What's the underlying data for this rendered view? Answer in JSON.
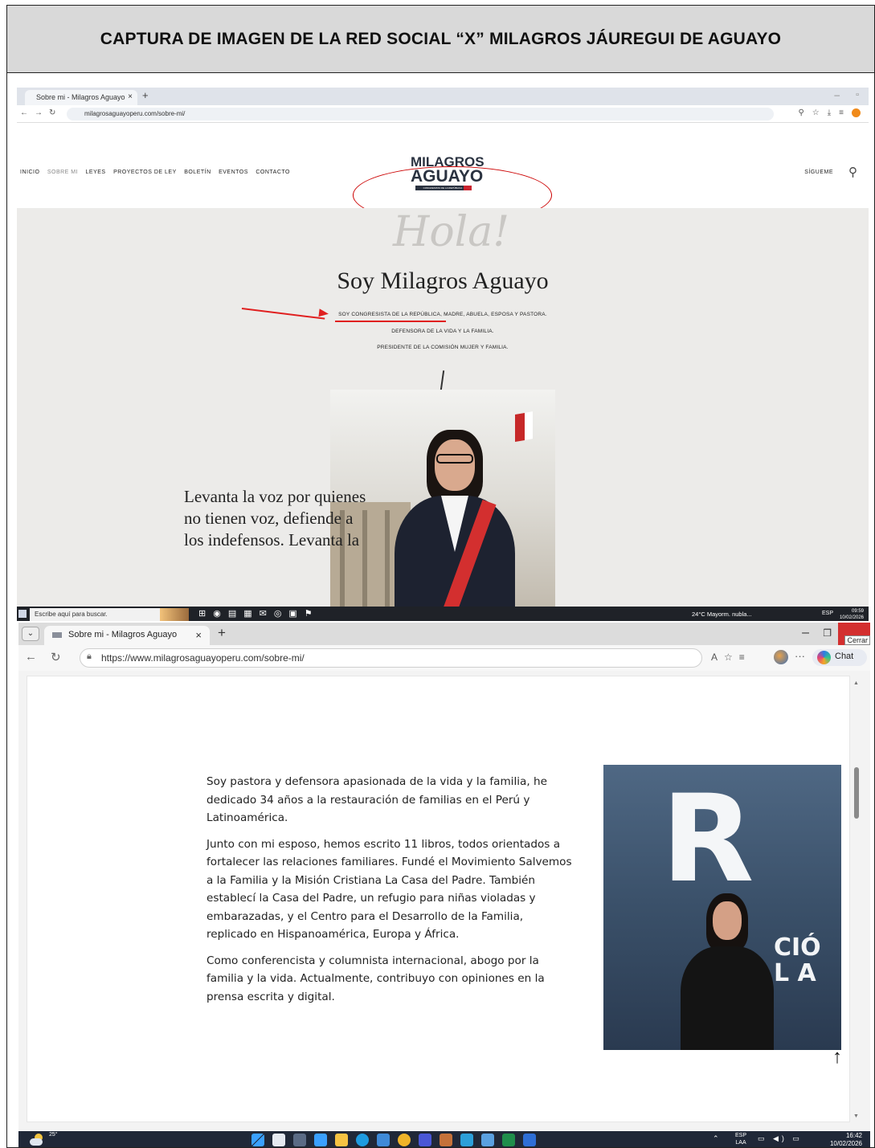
{
  "document": {
    "header_title": "CAPTURA DE IMAGEN DE LA RED SOCIAL “X” MILAGROS JÁUREGUI DE AGUAYO"
  },
  "screenshot1": {
    "browser": {
      "tab_title": "Sobre mi - Milagros Aguayo",
      "url": "milagrosaguayoperu.com/sobre-mi/"
    },
    "site": {
      "nav": [
        "INICIO",
        "SOBRE MI",
        "LEYES",
        "PROYECTOS DE LEY",
        "BOLETÍN",
        "EVENTOS",
        "CONTACTO"
      ],
      "logo_line1": "MILAGROS",
      "logo_line2": "AGUAYO",
      "logo_sub": "CONGRESISTA DE LA REPÚBLICA",
      "follow_label": "SÍGUEME"
    },
    "hero": {
      "greeting": "Hola!",
      "title": "Soy Milagros Aguayo",
      "subtitle_lines": [
        "SOY CONGRESISTA DE LA REPÚBLICA, MADRE, ABUELA, ESPOSA Y PASTORA.",
        "DEFENSORA DE LA VIDA Y LA FAMILIA.",
        "PRESIDENTE DE LA COMISIÓN MUJER Y FAMILIA."
      ],
      "quote_lines": [
        "Levanta la voz por quienes",
        "no tienen voz, defiende a",
        "los indefensos. Levanta la"
      ]
    },
    "taskbar": {
      "search_placeholder": "Escribe aquí para buscar.",
      "weather": "24°C Mayorm. nubla...",
      "lang": "ESP",
      "time": "09:59",
      "date": "10/02/2026"
    },
    "annotation_color": "#e02020"
  },
  "screenshot2": {
    "browser": {
      "tab_title": "Sobre mi - Milagros Aguayo",
      "url": "https://www.milagrosaguayoperu.com/sobre-mi/",
      "close_tooltip": "Cerrar",
      "chat_label": "Chat"
    },
    "content": {
      "paragraphs": [
        "Soy pastora y defensora apasionada de la vida y la familia, he dedicado 34 años a la restauración de familias en el Perú y Latinoamérica.",
        "Junto con mi esposo, hemos escrito 11 libros, todos orientados a fortalecer las relaciones familiares. Fundé el Movimiento Salvemos a la Familia y la Misión Cristiana La Casa del Padre. También establecí la Casa del Padre, un refugio para niñas violadas y embarazadas, y el Centro para el Desarrollo de la Familia, replicado en Hispanoamérica, Europa y África.",
        "Como conferencista y columnista internacional, abogo por la familia y la vida. Actualmente, contribuyo con opiniones en la prensa escrita y digital."
      ],
      "photo_letter": "R",
      "photo_text_line1": "CIÓ",
      "photo_text_line2": "L A"
    },
    "taskbar": {
      "temperature": "25°",
      "lang_line1": "ESP",
      "lang_line2": "LAA",
      "time": "16:42",
      "date": "10/02/2026"
    }
  }
}
